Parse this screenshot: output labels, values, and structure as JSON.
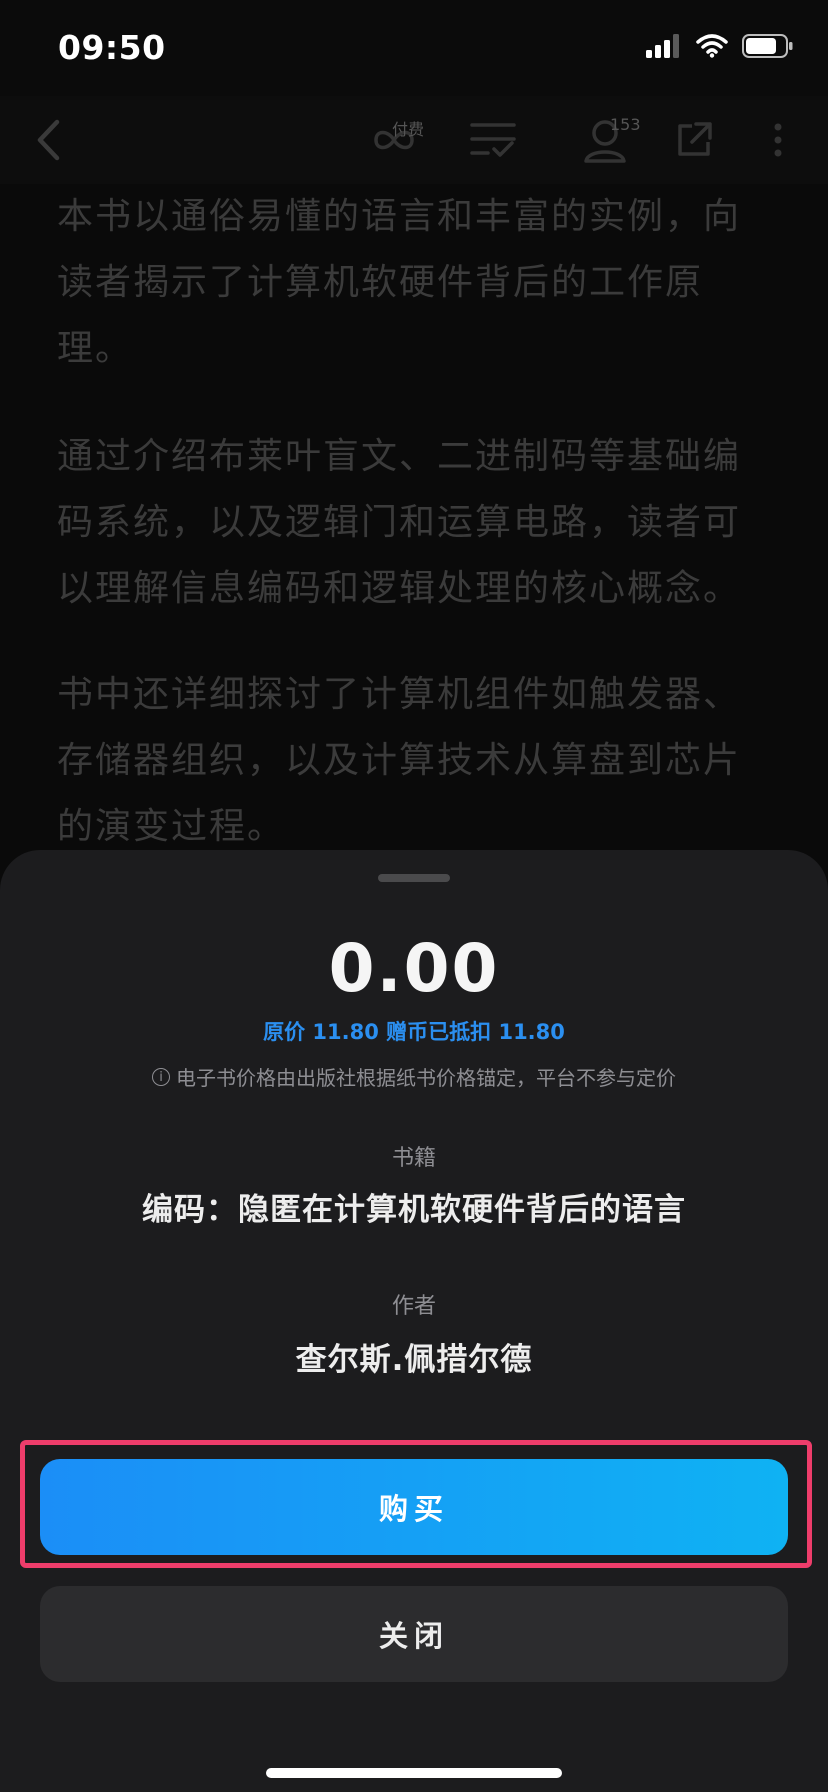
{
  "status": {
    "time": "09:50"
  },
  "nav": {
    "paid_label": "付费",
    "reader_count": "153"
  },
  "reader": {
    "paragraphs": [
      "本书以通俗易懂的语言和丰富的实例，向读者揭示了计算机软硬件背后的工作原理。",
      "通过介绍布莱叶盲文、二进制码等基础编码系统，以及逻辑门和运算电路，读者可以理解信息编码和逻辑处理的核心概念。",
      "书中还详细探讨了计算机组件如触发器、存储器组织，以及计算技术从算盘到芯片的演变过程。"
    ]
  },
  "sheet": {
    "price": "0.00",
    "price_detail": "原价 11.80 赠币已抵扣 11.80",
    "notice": "电子书价格由出版社根据纸书价格锚定，平台不参与定价",
    "book_label": "书籍",
    "book_title": "编码：隐匿在计算机软硬件背后的语言",
    "author_label": "作者",
    "author_name": "查尔斯.佩措尔德",
    "buy_label": "购买",
    "close_label": "关闭"
  },
  "colors": {
    "accent_blue": "#1b8ef7",
    "price_detail_blue": "#2b8ff0",
    "highlight_pink": "#ee3d6b",
    "sheet_bg": "#1c1c1e"
  }
}
